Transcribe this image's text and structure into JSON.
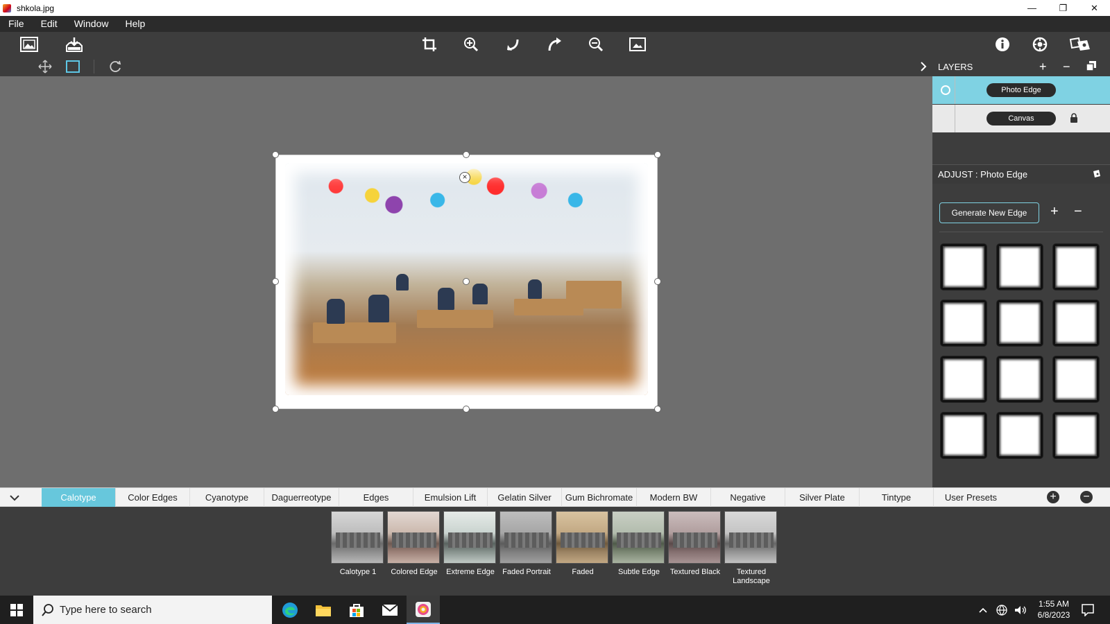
{
  "window": {
    "title": "shkola.jpg",
    "controls": {
      "minimize": "—",
      "maximize": "❐",
      "close": "✕"
    }
  },
  "menu": [
    "File",
    "Edit",
    "Window",
    "Help"
  ],
  "toolbar": {
    "left": [
      "open-image-icon",
      "save-export-icon"
    ],
    "center": [
      "crop-icon",
      "zoom-in-icon",
      "undo-icon",
      "redo-icon",
      "zoom-out-icon",
      "fit-to-screen-icon"
    ],
    "right": [
      "info-icon",
      "settings-icon",
      "presets-icon"
    ]
  },
  "toolbar2": [
    "move-tool-icon",
    "select-tool-icon",
    "rotate-tool-icon"
  ],
  "layers": {
    "title": "LAYERS",
    "items": [
      {
        "name": "Photo Edge",
        "active": true
      },
      {
        "name": "Canvas",
        "active": false,
        "locked": true
      }
    ]
  },
  "adjust": {
    "title": "ADJUST : Photo Edge",
    "generate_button": "Generate New Edge",
    "edge_count": 12
  },
  "presets": {
    "tabs": [
      {
        "label": "Calotype",
        "active": true
      },
      {
        "label": "Color Edges"
      },
      {
        "label": "Cyanotype"
      },
      {
        "label": "Daguerreotype"
      },
      {
        "label": "Edges"
      },
      {
        "label": "Emulsion Lift"
      },
      {
        "label": "Gelatin Silver"
      },
      {
        "label": "Gum Bichromate"
      },
      {
        "label": "Modern BW"
      },
      {
        "label": "Negative"
      },
      {
        "label": "Silver Plate"
      },
      {
        "label": "Tintype"
      },
      {
        "label": "User Presets"
      }
    ],
    "thumbs": [
      {
        "label": "Calotype 1"
      },
      {
        "label": "Colored Edge"
      },
      {
        "label": "Extreme Edge"
      },
      {
        "label": "Faded Portrait"
      },
      {
        "label": "Faded"
      },
      {
        "label": "Subtle Edge"
      },
      {
        "label": "Textured Black"
      },
      {
        "label": "Textured Landscape"
      }
    ]
  },
  "taskbar": {
    "search_placeholder": "Type here to search",
    "time": "1:55 AM",
    "date": "6/8/2023"
  },
  "colors": {
    "accent": "#67c7dc",
    "panel": "#3d3d3d",
    "canvas": "#6e6e6e"
  }
}
